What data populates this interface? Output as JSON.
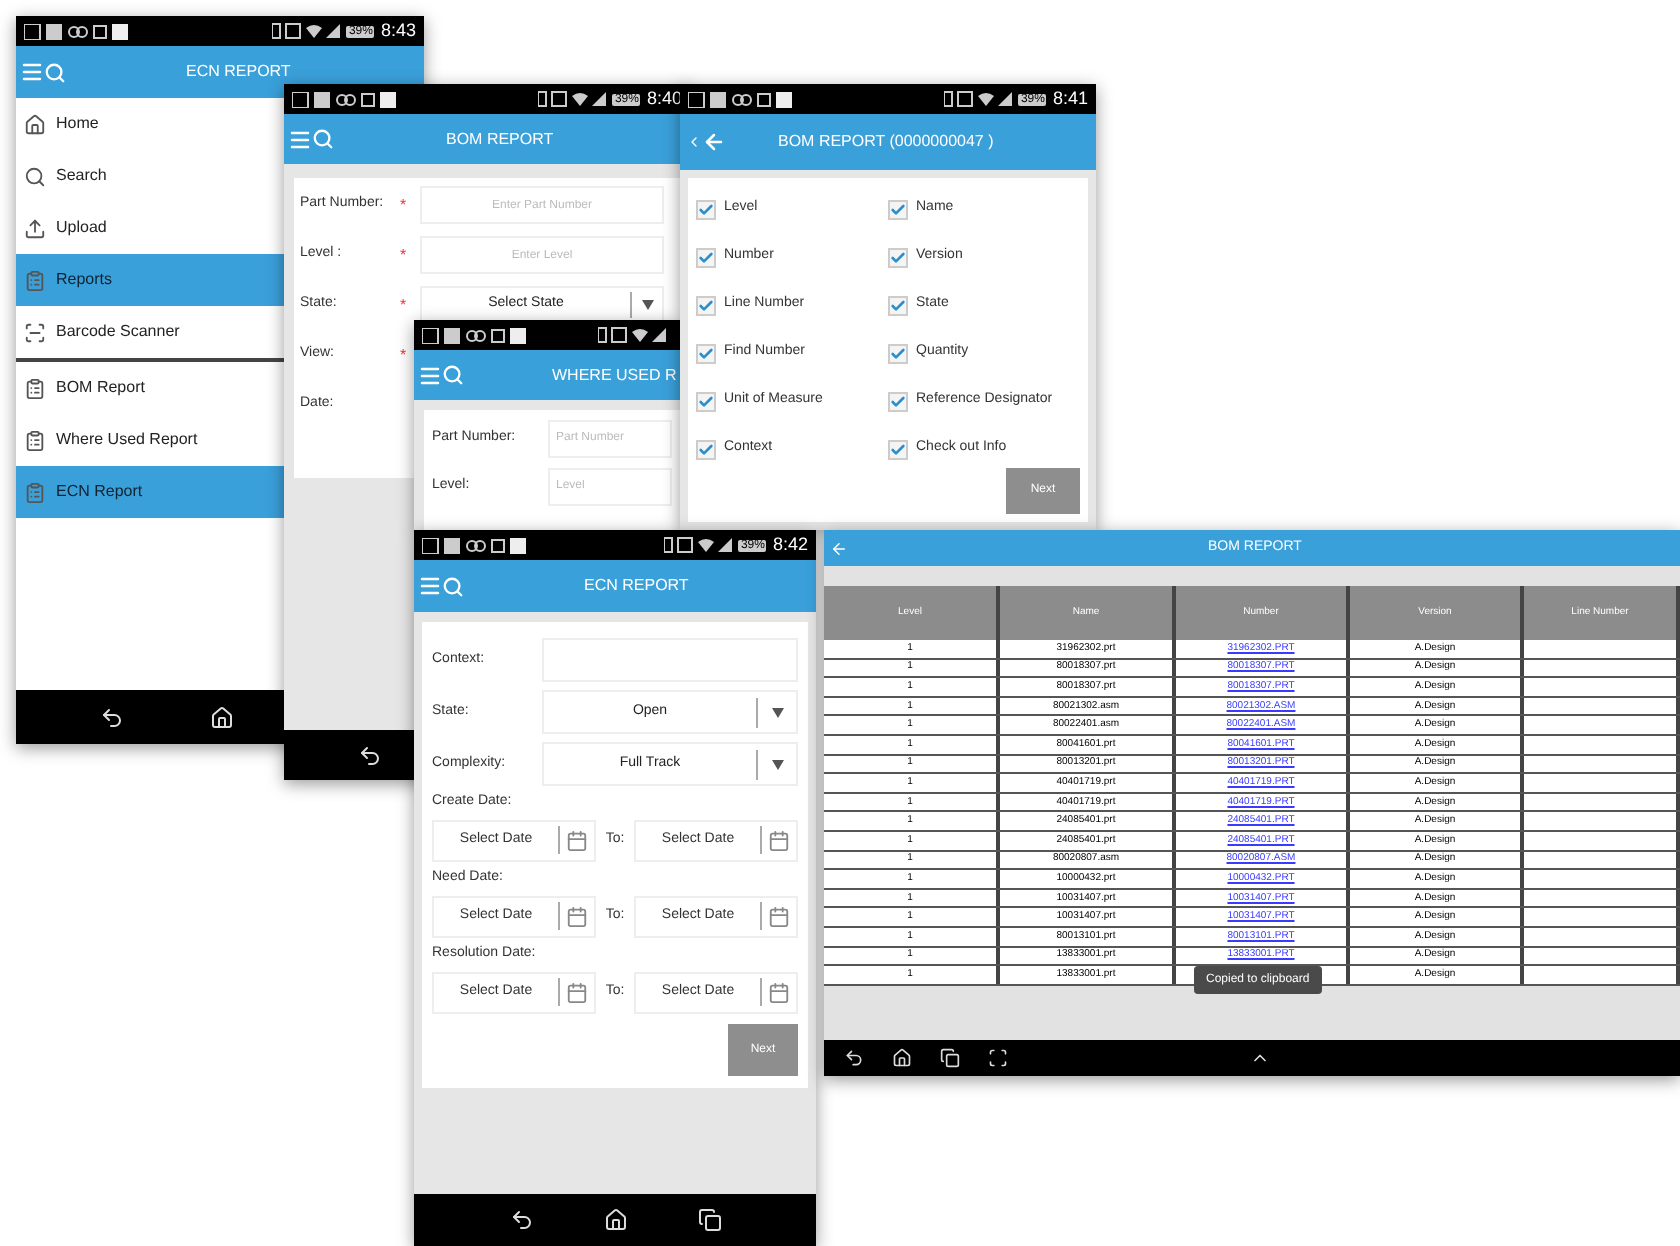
{
  "menu_screen": {
    "status_bar": {
      "time": "8:43",
      "battery": "39%"
    },
    "title": "ECN REPORT",
    "menu_groups": [
      [
        {
          "label": "Home",
          "kind": "home",
          "selected": false
        },
        {
          "label": "Search",
          "kind": "search",
          "selected": false
        },
        {
          "label": "Upload",
          "kind": "upload",
          "selected": false
        },
        {
          "label": "Reports",
          "kind": "report",
          "selected": true
        },
        {
          "label": "Barcode Scanner",
          "kind": "barcode",
          "selected": false
        }
      ],
      [
        {
          "label": "BOM Report",
          "kind": "report",
          "selected": false
        },
        {
          "label": "Where Used Report",
          "kind": "report",
          "selected": false
        },
        {
          "label": "ECN Report",
          "kind": "report",
          "selected": true
        }
      ]
    ]
  },
  "bom_form_screen": {
    "status_bar": {
      "time": "8:40",
      "battery": "39%"
    },
    "title": "BOM REPORT",
    "fields": [
      {
        "kind": "input",
        "label": "Part Number:",
        "required_mark": "*",
        "placeholder": "Enter Part Number"
      },
      {
        "kind": "input",
        "label": "Level :",
        "required_mark": "*",
        "placeholder": "Enter Level"
      },
      {
        "kind": "select",
        "label": "State:",
        "required_mark": "*",
        "value": "Select State"
      },
      {
        "kind": "label",
        "label": "View:",
        "required_mark": "*"
      },
      {
        "kind": "label",
        "label": "Date:"
      }
    ]
  },
  "bom_columns_screen": {
    "status_bar": {
      "time": "8:41",
      "battery": "39%"
    },
    "title": "BOM REPORT (0000000047 )",
    "options": [
      {
        "label": "Level",
        "checked": true
      },
      {
        "label": "Name",
        "checked": true
      },
      {
        "label": "Number",
        "checked": true
      },
      {
        "label": "Version",
        "checked": true
      },
      {
        "label": "Line Number",
        "checked": true
      },
      {
        "label": "State",
        "checked": true
      },
      {
        "label": "Find Number",
        "checked": true
      },
      {
        "label": "Quantity",
        "checked": true
      },
      {
        "label": "Unit of Measure",
        "checked": true
      },
      {
        "label": "Reference Designator",
        "checked": true
      },
      {
        "label": "Context",
        "checked": true
      },
      {
        "label": "Check out Info",
        "checked": true
      }
    ],
    "button": "Next"
  },
  "where_used_screen": {
    "title": "WHERE USED R",
    "fields": [
      {
        "label": "Part Number:",
        "placeholder": "Part Number"
      },
      {
        "label": "Level:",
        "placeholder": "Level"
      }
    ]
  },
  "ecn_screen": {
    "status_bar": {
      "time": "8:42",
      "battery": "39%"
    },
    "title": "ECN REPORT",
    "fields": [
      {
        "kind": "input",
        "label": "Context:"
      },
      {
        "kind": "select",
        "label": "State:",
        "value": "Open"
      },
      {
        "kind": "select",
        "label": "Complexity:",
        "value": "Full Track"
      }
    ],
    "date_ranges": [
      {
        "label": "Create Date:",
        "from": "Select Date",
        "to_label": "To:",
        "to": "Select Date"
      },
      {
        "label": "Need Date:",
        "from": "Select Date",
        "to_label": "To:",
        "to": "Select Date"
      },
      {
        "label": "Resolution Date:",
        "from": "Select Date",
        "to_label": "To:",
        "to": "Select Date"
      }
    ],
    "button": "Next"
  },
  "bom_table_screen": {
    "title": "BOM REPORT",
    "columns": [
      "Level",
      "Name",
      "Number",
      "Version",
      "Line Number"
    ],
    "rows": [
      {
        "level": "1",
        "name": "31962302.prt",
        "number": "31962302.PRT",
        "version": "A.Design"
      },
      {
        "level": "1",
        "name": "80018307.prt",
        "number": "80018307.PRT",
        "version": "A.Design"
      },
      {
        "level": "1",
        "name": "80018307.prt",
        "number": "80018307.PRT",
        "version": "A.Design"
      },
      {
        "level": "1",
        "name": "80021302.asm",
        "number": "80021302.ASM",
        "version": "A.Design"
      },
      {
        "level": "1",
        "name": "80022401.asm",
        "number": "80022401.ASM",
        "version": "A.Design"
      },
      {
        "level": "1",
        "name": "80041601.prt",
        "number": "80041601.PRT",
        "version": "A.Design"
      },
      {
        "level": "1",
        "name": "80013201.prt",
        "number": "80013201.PRT",
        "version": "A.Design"
      },
      {
        "level": "1",
        "name": "40401719.prt",
        "number": "40401719.PRT",
        "version": "A.Design"
      },
      {
        "level": "1",
        "name": "40401719.prt",
        "number": "40401719.PRT",
        "version": "A.Design"
      },
      {
        "level": "1",
        "name": "24085401.prt",
        "number": "24085401.PRT",
        "version": "A.Design"
      },
      {
        "level": "1",
        "name": "24085401.prt",
        "number": "24085401.PRT",
        "version": "A.Design"
      },
      {
        "level": "1",
        "name": "80020807.asm",
        "number": "80020807.ASM",
        "version": "A.Design"
      },
      {
        "level": "1",
        "name": "10000432.prt",
        "number": "10000432.PRT",
        "version": "A.Design"
      },
      {
        "level": "1",
        "name": "10031407.prt",
        "number": "10031407.PRT",
        "version": "A.Design"
      },
      {
        "level": "1",
        "name": "10031407.prt",
        "number": "10031407.PRT",
        "version": "A.Design"
      },
      {
        "level": "1",
        "name": "80013101.prt",
        "number": "80013101.PRT",
        "version": "A.Design"
      },
      {
        "level": "1",
        "name": "13833001.prt",
        "number": "13833001.PRT",
        "version": "A.Design"
      },
      {
        "level": "1",
        "name": "13833001.prt",
        "version": "A.Design"
      }
    ],
    "toast": "Copied to clipboard"
  }
}
